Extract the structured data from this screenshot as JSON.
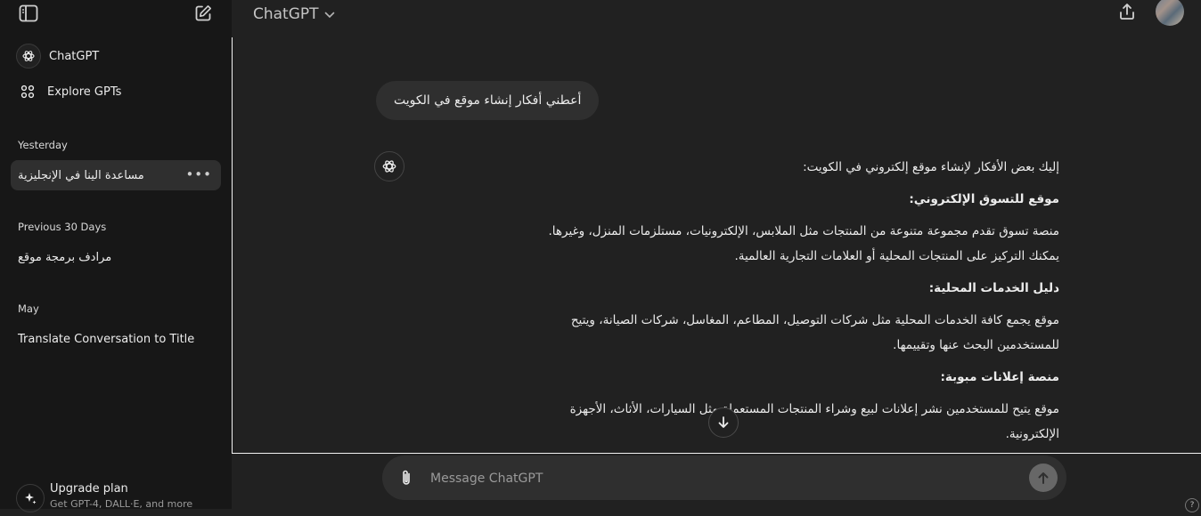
{
  "sidebar": {
    "nav": [
      {
        "label": "ChatGPT",
        "icon": "openai-logo-icon"
      },
      {
        "label": "Explore GPTs",
        "icon": "grid-icon"
      }
    ],
    "sections": [
      {
        "label": "Yesterday",
        "items": [
          "مساعدة الينا في الإنجليزية"
        ]
      },
      {
        "label": "Previous 30 Days",
        "items": [
          "مرادف برمجة موقع"
        ]
      },
      {
        "label": "May",
        "items": [
          "Translate Conversation to Title"
        ]
      }
    ],
    "upgrade": {
      "title": "Upgrade plan",
      "subtitle": "Get GPT-4, DALL·E, and more"
    }
  },
  "header": {
    "title": "ChatGPT"
  },
  "chat": {
    "user_message": "أعطني أفكار إنشاء موقع في الكويت",
    "answer": {
      "intro": "إليك بعض الأفكار لإنشاء موقع إلكتروني في الكويت:",
      "h1": "موقع للتسوق الإلكتروني:",
      "p1a": "منصة تسوق تقدم مجموعة متنوعة من المنتجات مثل الملابس، الإلكترونيات، مستلزمات المنزل، وغيرها.",
      "p1b": "يمكنك التركيز على المنتجات المحلية أو العلامات التجارية العالمية.",
      "h2": "دليل الخدمات المحلية:",
      "p2a": "موقع يجمع كافة الخدمات المحلية مثل شركات التوصيل، المطاعم، المغاسل، شركات الصيانة، ويتيح",
      "p2b": "للمستخدمين البحث عنها وتقييمها.",
      "h3": "منصة إعلانات مبوبة:",
      "p3a": "موقع يتيح للمستخدمين نشر إعلانات لبيع وشراء المنتجات المستعملة مثل السيارات، الأثاث، الأجهزة",
      "p3b": "الإلكترونية."
    }
  },
  "composer": {
    "placeholder": "Message ChatGPT"
  },
  "help": "?"
}
